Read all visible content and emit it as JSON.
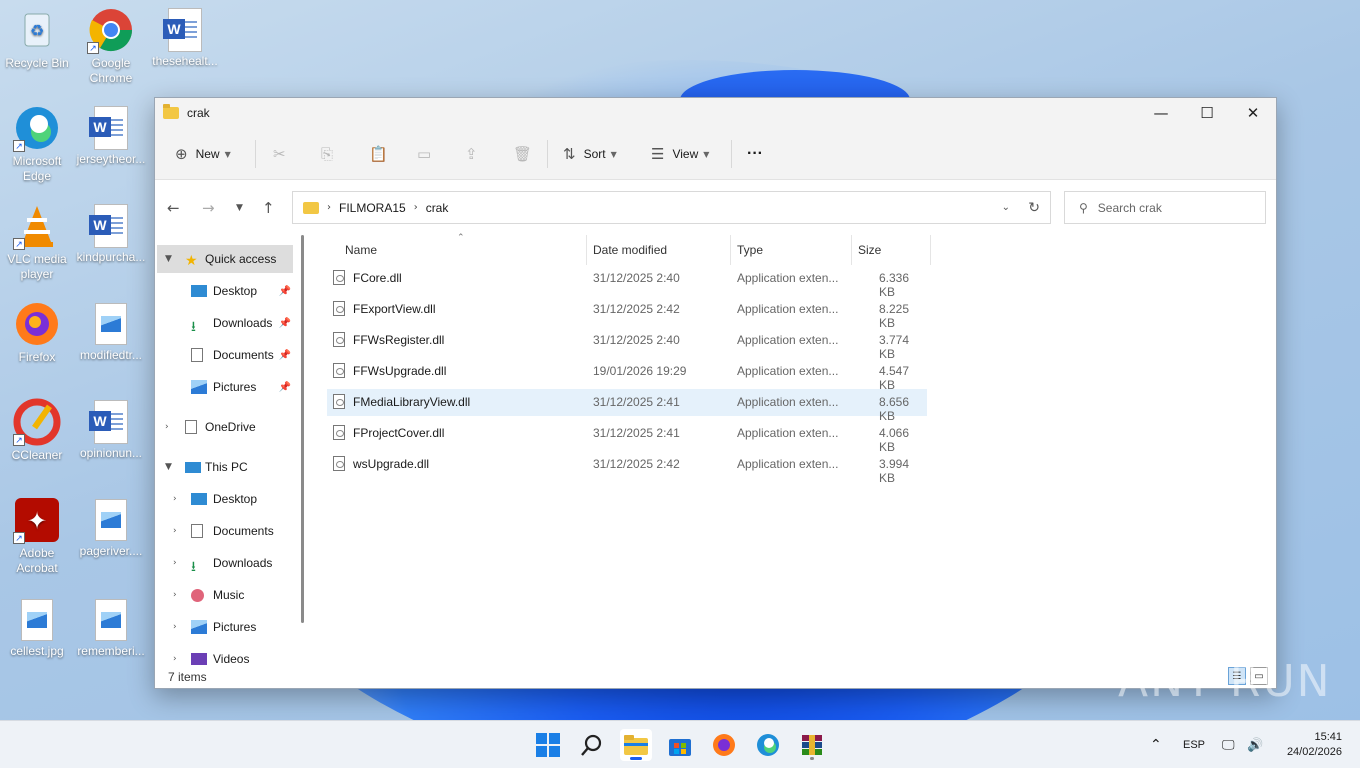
{
  "desktop": {
    "icons": [
      {
        "label": "Recycle Bin"
      },
      {
        "label": "Google Chrome"
      },
      {
        "label": "thesehealt..."
      },
      {
        "label": "Microsoft Edge"
      },
      {
        "label": "jerseytheor..."
      },
      {
        "label": "VLC media player"
      },
      {
        "label": "kindpurcha..."
      },
      {
        "label": "Firefox"
      },
      {
        "label": "modifiedtr..."
      },
      {
        "label": "CCleaner"
      },
      {
        "label": "opinionun..."
      },
      {
        "label": "Adobe Acrobat"
      },
      {
        "label": "pageriver...."
      },
      {
        "label": "cellest.jpg"
      },
      {
        "label": "rememberi..."
      }
    ]
  },
  "window": {
    "title": "crak",
    "controls": {
      "minimize": "—",
      "maximize": "☐",
      "close": "✕"
    }
  },
  "toolbar": {
    "new_label": "New",
    "sort_label": "Sort",
    "view_label": "View",
    "more_label": "···"
  },
  "address": {
    "crumbs": [
      "FILMORA15",
      "crak"
    ],
    "search_placeholder": "Search crak"
  },
  "nav": {
    "quick_access": "Quick access",
    "desktop": "Desktop",
    "downloads": "Downloads",
    "documents": "Documents",
    "pictures": "Pictures",
    "onedrive": "OneDrive",
    "this_pc": "This PC",
    "pc_desktop": "Desktop",
    "pc_documents": "Documents",
    "pc_downloads": "Downloads",
    "pc_music": "Music",
    "pc_pictures": "Pictures",
    "pc_videos": "Videos"
  },
  "columns": {
    "name": "Name",
    "date": "Date modified",
    "type": "Type",
    "size": "Size"
  },
  "files": [
    {
      "name": "FCore.dll",
      "date": "31/12/2025 2:40",
      "type": "Application exten...",
      "size": "6.336 KB"
    },
    {
      "name": "FExportView.dll",
      "date": "31/12/2025 2:42",
      "type": "Application exten...",
      "size": "8.225 KB"
    },
    {
      "name": "FFWsRegister.dll",
      "date": "31/12/2025 2:40",
      "type": "Application exten...",
      "size": "3.774 KB"
    },
    {
      "name": "FFWsUpgrade.dll",
      "date": "19/01/2026 19:29",
      "type": "Application exten...",
      "size": "4.547 KB"
    },
    {
      "name": "FMediaLibraryView.dll",
      "date": "31/12/2025 2:41",
      "type": "Application exten...",
      "size": "8.656 KB"
    },
    {
      "name": "FProjectCover.dll",
      "date": "31/12/2025 2:41",
      "type": "Application exten...",
      "size": "4.066 KB"
    },
    {
      "name": "wsUpgrade.dll",
      "date": "31/12/2025 2:42",
      "type": "Application exten...",
      "size": "3.994 KB"
    }
  ],
  "status": {
    "items": "7 items"
  },
  "taskbar": {
    "language": "ESP",
    "time": "15:41",
    "date": "24/02/2026"
  },
  "watermark": "ANY RUN"
}
